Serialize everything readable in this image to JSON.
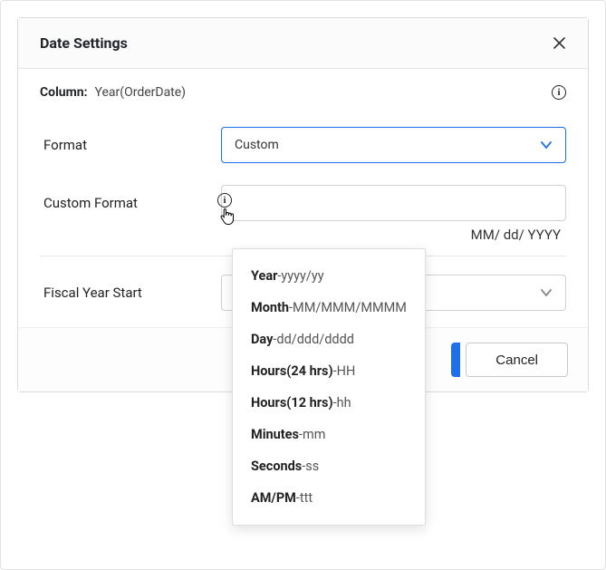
{
  "dialog": {
    "title": "Date Settings",
    "column_label": "Column:",
    "column_value": "Year(OrderDate)",
    "format_label": "Format",
    "format_value": "Custom",
    "custom_format_label": "Custom Format",
    "custom_format_value": "",
    "hint": "MM/ dd/ YYYY",
    "fiscal_label": "Fiscal Year Start",
    "fiscal_value": "",
    "cancel": "Cancel"
  },
  "popover": [
    {
      "strong": "Year",
      "light": "-yyyy/yy"
    },
    {
      "strong": "Month",
      "light": "-MM/MMM/MMMM"
    },
    {
      "strong": "Day",
      "light": "-dd/ddd/dddd"
    },
    {
      "strong": "Hours(24 hrs)",
      "light": "-HH"
    },
    {
      "strong": "Hours(12 hrs)",
      "light": "-hh"
    },
    {
      "strong": "Minutes",
      "light": "-mm"
    },
    {
      "strong": "Seconds",
      "light": "-ss"
    },
    {
      "strong": "AM/PM",
      "light": "-ttt"
    }
  ]
}
